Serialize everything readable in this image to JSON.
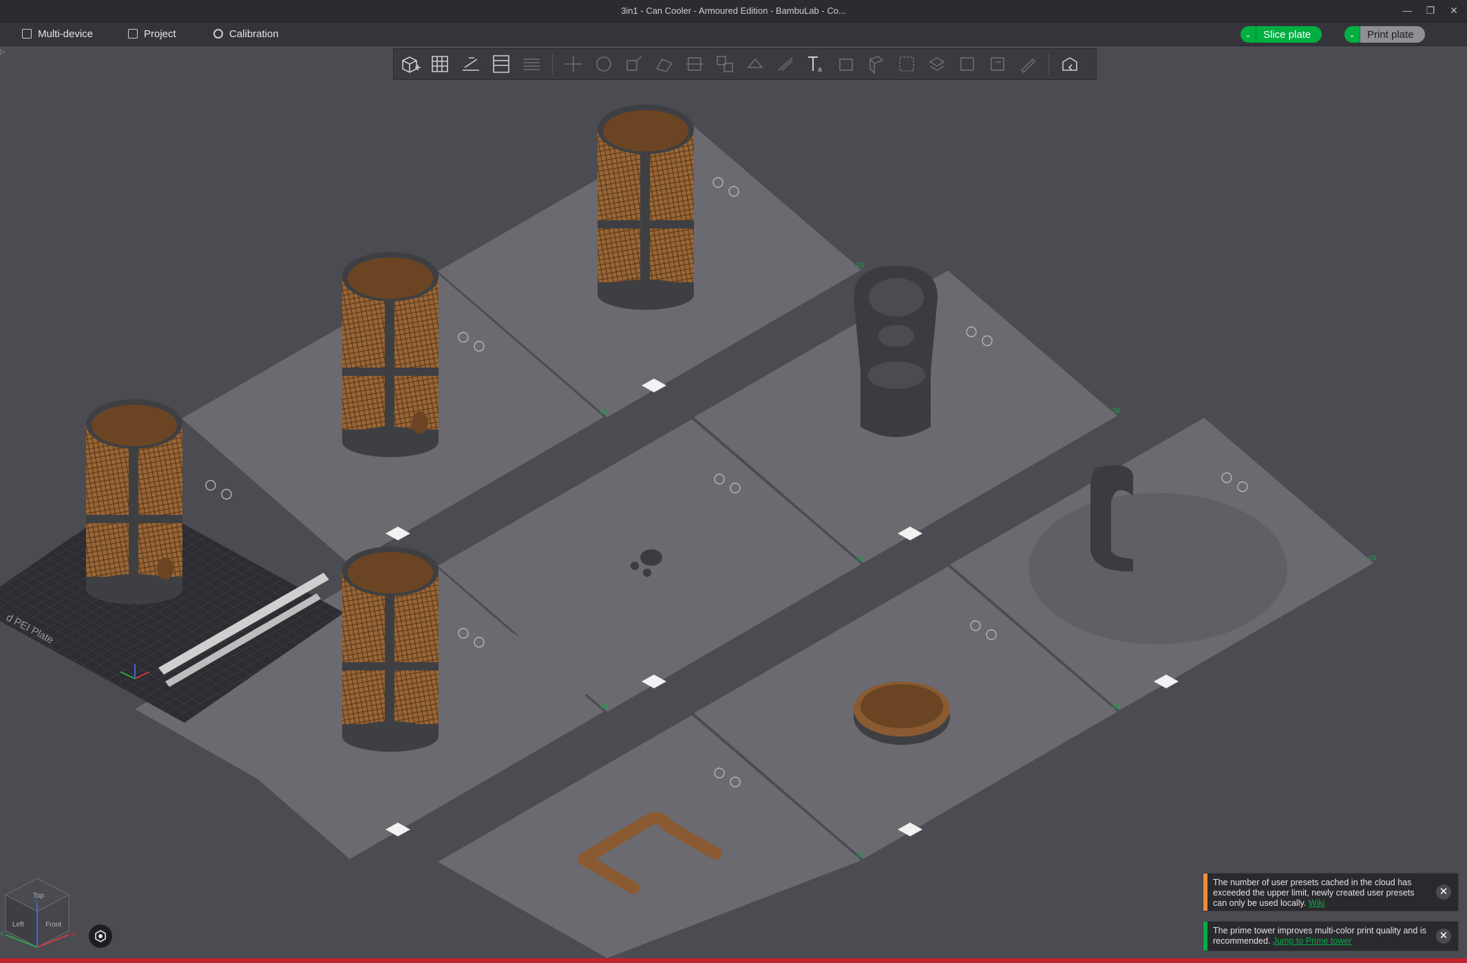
{
  "window": {
    "title": "3in1 - Can Cooler - Armoured Edition - BambuLab - Co...",
    "controls": [
      "minimize-icon",
      "restore-icon",
      "close-icon"
    ]
  },
  "menubar": {
    "items": [
      {
        "label": "Multi-device",
        "icon": "multi-device-icon"
      },
      {
        "label": "Project",
        "icon": "project-icon"
      },
      {
        "label": "Calibration",
        "icon": "calibration-gear-icon"
      }
    ],
    "slice_label": "Slice plate",
    "print_label": "Print plate"
  },
  "toolbar": {
    "icons": [
      "add-object-icon",
      "arrange-grid-icon",
      "auto-orient-icon",
      "split-plate-icon",
      "layers-icon",
      "move-icon",
      "rotate-icon",
      "scale-icon",
      "lay-on-face-icon",
      "cut-icon",
      "split-objects-icon",
      "mesh-boolean-icon",
      "support-paint-icon",
      "seam-paint-icon",
      "color-paint-icon",
      "text-tool-icon",
      "emboss-icon",
      "measure-icon",
      "assembly-icon",
      "drill-icon",
      "reduce-icon",
      "variable-layer-icon",
      "edit-icon",
      "assembly-view-icon"
    ]
  },
  "plate": {
    "bed_label": "d PEI Plate",
    "plate_numbers": [
      "01",
      "02",
      "03",
      "04",
      "05",
      "06",
      "07",
      "08",
      "09"
    ]
  },
  "viewcube": {
    "faces": [
      "Top",
      "Left",
      "Front"
    ],
    "axes": [
      "X",
      "Y",
      "Z"
    ]
  },
  "notifications": [
    {
      "text": "The number of user presets cached in the cloud has exceeded the upper limit, newly created user presets can only be used locally.",
      "link": "Wiki",
      "color": "#f28c3b"
    },
    {
      "text": "The prime tower improves multi-color print quality and is recommended.",
      "link": "Jump to Prime tower",
      "color": "#00ae42"
    }
  ],
  "colors": {
    "accent": "#00ae42",
    "bottom_strip": "#c0242c",
    "object_brown": "#8a5a32",
    "object_dark": "#3e3f42"
  }
}
